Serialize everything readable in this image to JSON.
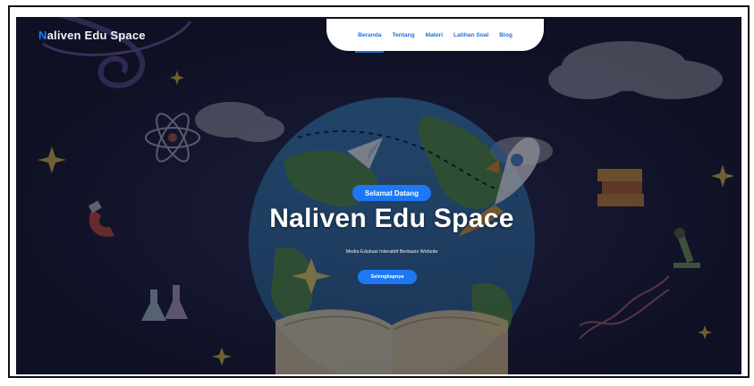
{
  "brand": {
    "first_letter": "N",
    "rest": "aliven Edu Space"
  },
  "nav": {
    "items": [
      {
        "label": "Beranda",
        "active": true
      },
      {
        "label": "Tentang",
        "active": false
      },
      {
        "label": "Materi",
        "active": false
      },
      {
        "label": "Latihan Soal",
        "active": false
      },
      {
        "label": "Blog",
        "active": false
      }
    ]
  },
  "hero": {
    "badge": "Selamat Datang",
    "title": "Naliven Edu Space",
    "subtitle": "Media Edukasi Interaktif Berbasis Website",
    "cta_label": "Selengkapnya"
  },
  "colors": {
    "accent": "#1e78f5",
    "nav_text": "#1e6fd9",
    "background": "#15172b"
  },
  "icons": [
    "atom-icon",
    "magnet-icon",
    "rocket-icon",
    "paper-plane-icon",
    "books-icon",
    "microscope-icon",
    "dna-icon",
    "flask-icon",
    "globe-icon",
    "open-book-icon",
    "cloud-icon",
    "star-icon"
  ]
}
